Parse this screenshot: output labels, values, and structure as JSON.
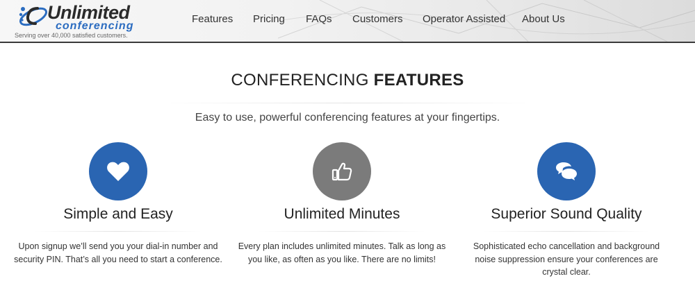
{
  "header": {
    "logo": {
      "word1": "Unlimited",
      "word2": "conferencing"
    },
    "tagline": "Serving over 40,000 satisfied customers.",
    "nav": [
      {
        "label": "Features"
      },
      {
        "label": "Pricing"
      },
      {
        "label": "FAQs"
      },
      {
        "label": "Customers"
      },
      {
        "label": "Operator Assisted"
      },
      {
        "label": "About Us"
      }
    ]
  },
  "main": {
    "title_light": "CONFERENCING ",
    "title_bold": "FEATURES",
    "subtitle": "Easy to use, powerful conferencing features at your fingertips.",
    "features": [
      {
        "icon": "heart-icon",
        "color": "#2a65b2",
        "title": "Simple and Easy",
        "text": "Upon signup we’ll send you your dial-in number and security PIN. That’s all you need to start a conference."
      },
      {
        "icon": "thumbs-up-icon",
        "color": "#7b7b7b",
        "title": "Unlimited Minutes",
        "text": "Every plan includes unlimited minutes. Talk as long as you like, as often as you like. There are no limits!"
      },
      {
        "icon": "chat-bubbles-icon",
        "color": "#2a65b2",
        "title": "Superior Sound Quality",
        "text": "Sophisticated echo cancellation and background noise suppression ensure your conferences are crystal clear."
      }
    ]
  }
}
